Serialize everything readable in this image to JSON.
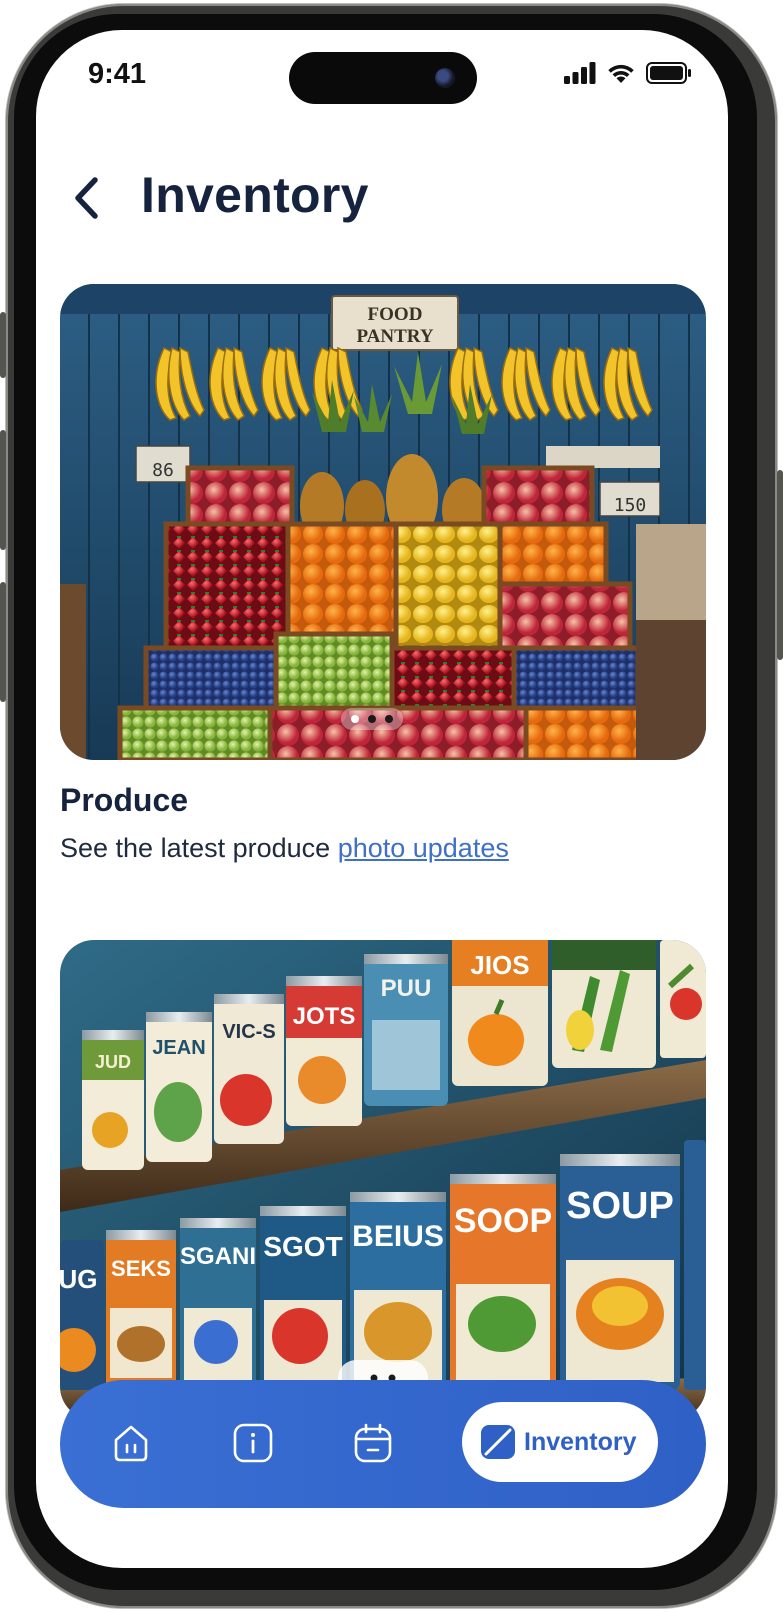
{
  "status_bar": {
    "time": "9:41"
  },
  "header": {
    "title": "Inventory"
  },
  "produce_card": {
    "title": "Produce",
    "description": "See the latest produce ",
    "link_text": "photo updates",
    "photo_sign": [
      "FOOD",
      "PANTRY"
    ],
    "price_tags": [
      "86",
      "150"
    ],
    "carousel": {
      "total": 3,
      "active_index": 0
    }
  },
  "canned_card": {
    "can_labels": [
      "JUD",
      "JEAN",
      "VIC-S",
      "JOTS",
      "PUU",
      "JIOS",
      "UG",
      "SEKS",
      "SGANI",
      "SGOT",
      "BEIUS",
      "SOOP",
      "SOUP"
    ]
  },
  "bottom_nav": {
    "items": [
      {
        "icon": "home-icon",
        "active": false
      },
      {
        "icon": "info-icon",
        "active": false
      },
      {
        "icon": "calendar-icon",
        "active": false
      },
      {
        "icon": "inventory-icon",
        "label": "Inventory",
        "active": true
      }
    ]
  },
  "colors": {
    "title": "#15233f",
    "link": "#3f6fc7",
    "nav_background": "#2f60c6",
    "nav_active_pill": "#ffffff"
  }
}
